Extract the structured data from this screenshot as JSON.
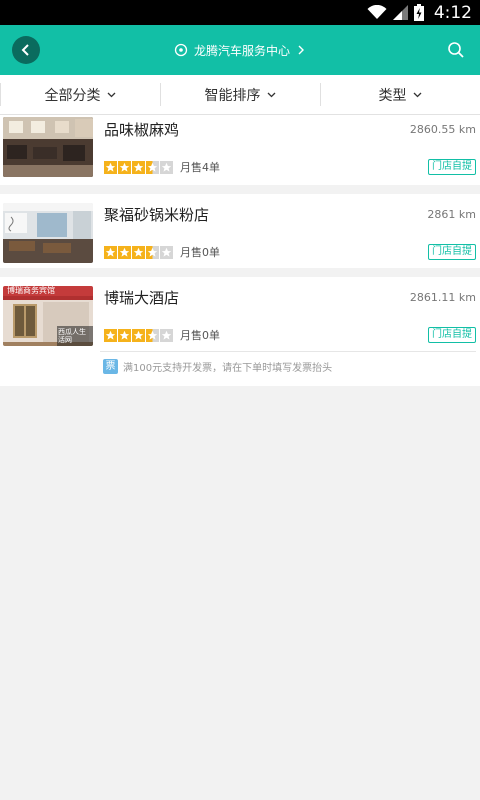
{
  "status_bar": {
    "time": "4:12"
  },
  "header": {
    "location": "龙腾汽车服务中心"
  },
  "filters": [
    {
      "label": "全部分类"
    },
    {
      "label": "智能排序"
    },
    {
      "label": "类型"
    }
  ],
  "stores": [
    {
      "name": "品味椒麻鸡",
      "distance": "2860.55 km",
      "rating": 3.5,
      "sales": "月售4单",
      "tag": "门店自提"
    },
    {
      "name": "聚福砂锅米粉店",
      "distance": "2861 km",
      "rating": 3.5,
      "sales": "月售0单",
      "tag": "门店自提"
    },
    {
      "name": "博瑞大酒店",
      "distance": "2861.11 km",
      "rating": 3.5,
      "sales": "月售0单",
      "tag": "门店自提",
      "invoice": {
        "badge": "票",
        "text": "满100元支持开发票，请在下单时填写发票抬头"
      },
      "thumb_sign": "博瑞商务宾馆",
      "thumb_watermark": "西瓜人生活网"
    }
  ],
  "colors": {
    "accent": "#12bfa6",
    "star": "#f5b21b",
    "star_empty": "#d6d6d6"
  }
}
